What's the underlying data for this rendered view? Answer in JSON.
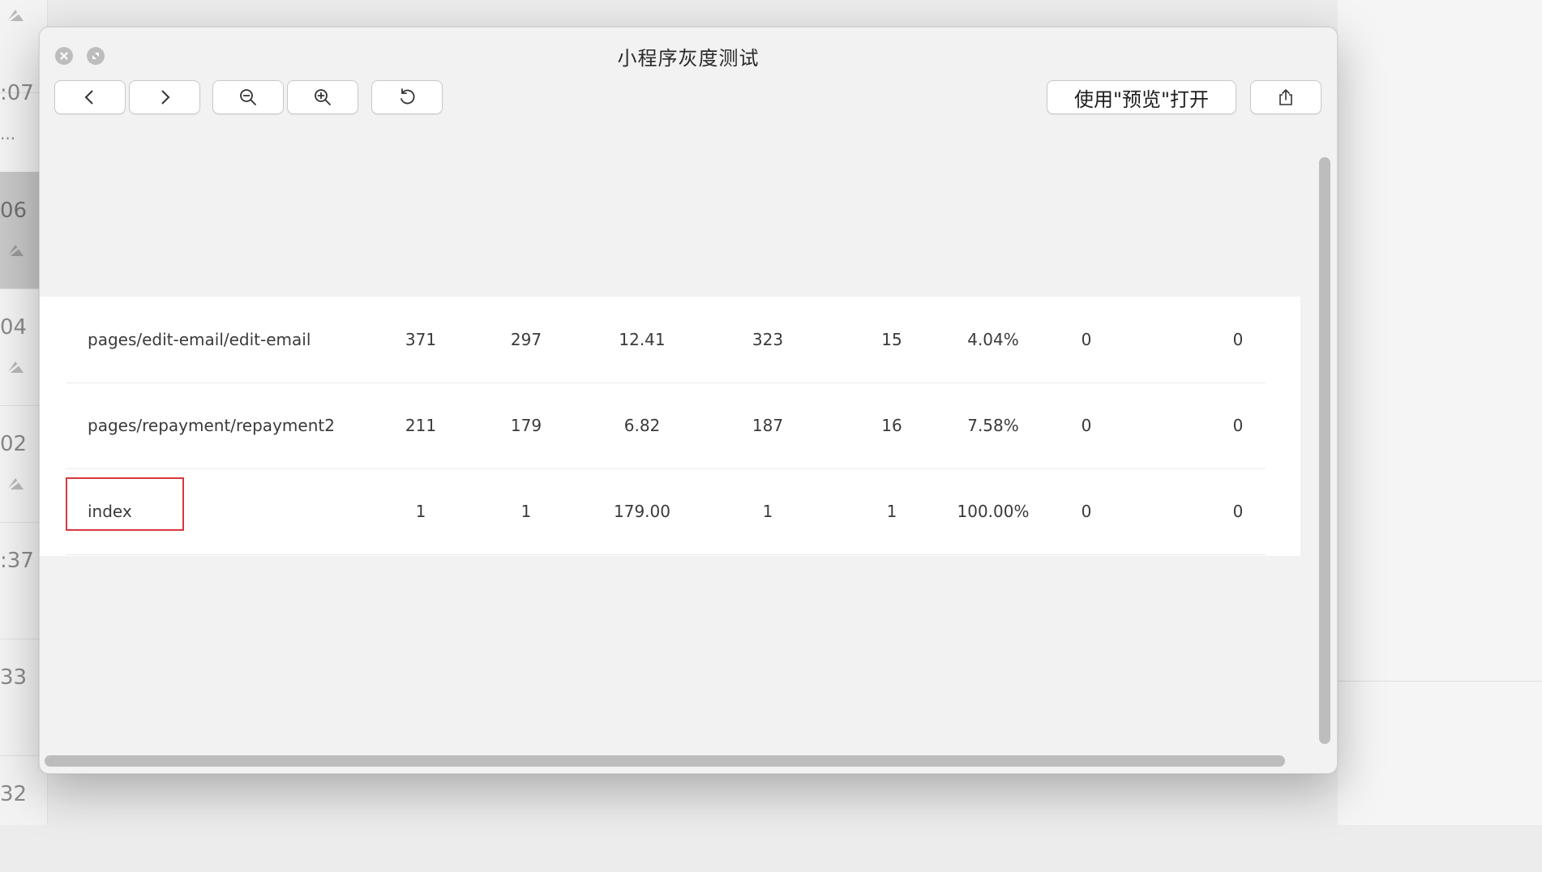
{
  "background": {
    "times": [
      ":07",
      "06",
      "04",
      "02",
      ":37",
      "33",
      "32"
    ],
    "ellipsis": "..."
  },
  "window": {
    "title": "小程序灰度测试",
    "toolbar": {
      "open_with_preview": "使用\"预览\"打开"
    }
  },
  "table": {
    "rows": [
      [
        "pages/edit-email/edit-email",
        "371",
        "297",
        "12.41",
        "323",
        "15",
        "4.04%",
        "0",
        "0"
      ],
      [
        "pages/repayment/repayment2",
        "211",
        "179",
        "6.82",
        "187",
        "16",
        "7.58%",
        "0",
        "0"
      ],
      [
        "index",
        "1",
        "1",
        "179.00",
        "1",
        "1",
        "100.00%",
        "0",
        "0"
      ]
    ]
  },
  "colors": {
    "highlight_border": "#d9383e",
    "window_bg": "#f2f2f2"
  }
}
